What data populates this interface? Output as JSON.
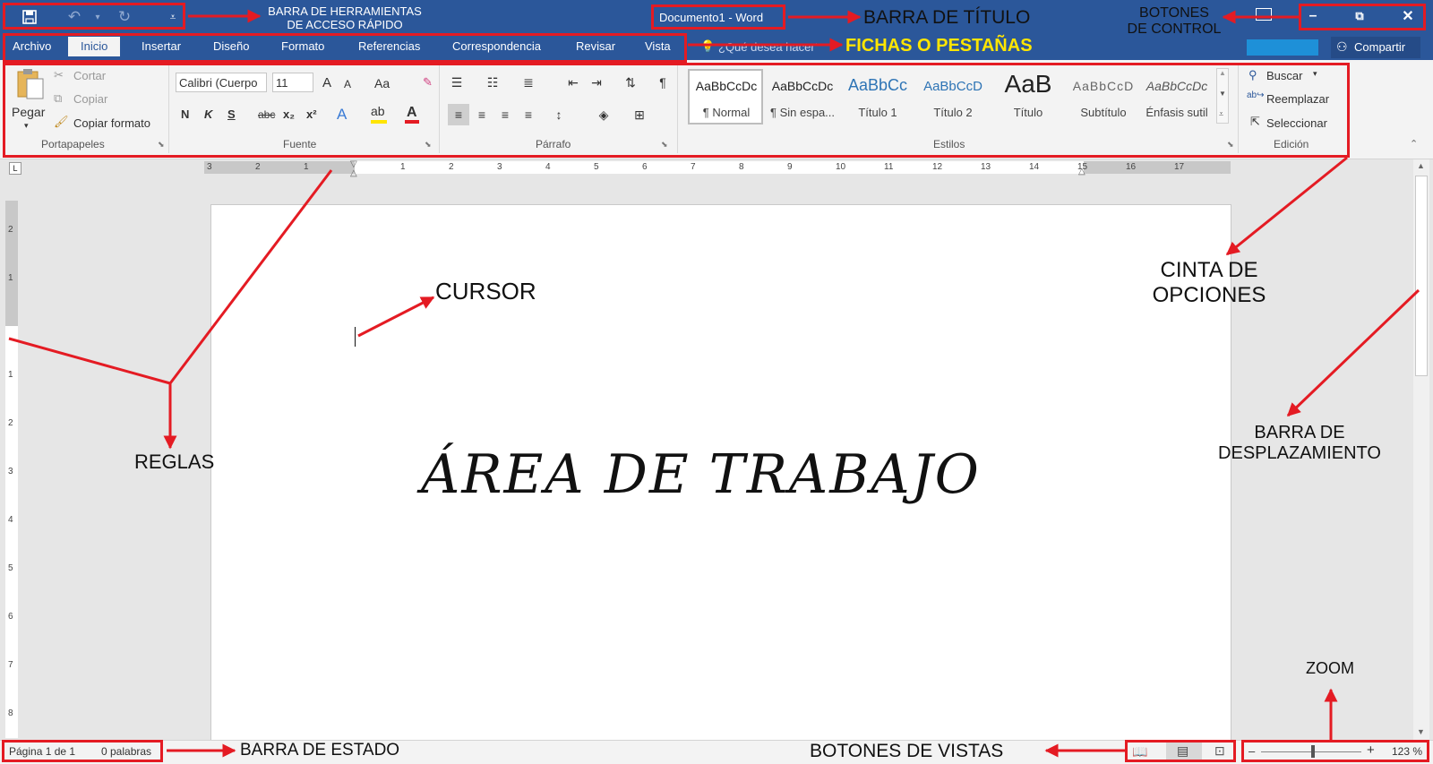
{
  "window": {
    "title": "Documento1 - Word",
    "controls": [
      "minimize-icon",
      "restore-icon",
      "close-icon"
    ]
  },
  "tabs": [
    {
      "label": "Archivo"
    },
    {
      "label": "Inicio",
      "active": true
    },
    {
      "label": "Insertar"
    },
    {
      "label": "Diseño"
    },
    {
      "label": "Formato"
    },
    {
      "label": "Referencias"
    },
    {
      "label": "Correspondencia"
    },
    {
      "label": "Revisar"
    },
    {
      "label": "Vista"
    }
  ],
  "tell_me": {
    "placeholder": "¿Qué desea hacer?"
  },
  "share": {
    "label": "Compartir"
  },
  "ribbon": {
    "clipboard": {
      "paste": "Pegar",
      "cut": "Cortar",
      "copy": "Copiar",
      "format_painter": "Copiar formato",
      "label": "Portapapeles"
    },
    "font": {
      "family": "Calibri (Cuerpo",
      "size": "11",
      "case": "Aa",
      "bold": "N",
      "italic": "K",
      "underline": "S",
      "strike": "abc",
      "sub": "x₂",
      "sup": "x²",
      "grow": "A",
      "shrink": "A",
      "label": "Fuente"
    },
    "paragraph": {
      "label": "Párrafo"
    },
    "styles": {
      "items": [
        {
          "sample": "AaBbCcDc",
          "name": "¶ Normal"
        },
        {
          "sample": "AaBbCcDc",
          "name": "¶ Sin espa..."
        },
        {
          "sample": "AaBbCc",
          "name": "Título 1"
        },
        {
          "sample": "AaBbCcD",
          "name": "Título 2"
        },
        {
          "sample": "AaB",
          "name": "Título"
        },
        {
          "sample": "AaBbCcD",
          "name": "Subtítulo"
        },
        {
          "sample": "AaBbCcDc",
          "name": "Énfasis sutil"
        }
      ],
      "label": "Estilos"
    },
    "editing": {
      "find": "Buscar",
      "replace": "Reemplazar",
      "select": "Seleccionar",
      "label": "Edición"
    }
  },
  "ruler": {
    "h_numbers": [
      "3",
      "2",
      "1",
      "1",
      "2",
      "3",
      "4",
      "5",
      "6",
      "7",
      "8",
      "9",
      "10",
      "11",
      "12",
      "13",
      "14",
      "15",
      "16",
      "17"
    ],
    "v_numbers": [
      "2",
      "1",
      "1",
      "2",
      "3",
      "4",
      "5",
      "6",
      "7",
      "8"
    ]
  },
  "document": {
    "text": "ÁREA DE TRABAJO"
  },
  "status": {
    "page": "Página 1 de 1",
    "words": "0 palabras",
    "zoom": "123 %"
  },
  "annotations": {
    "qat": "BARRA DE HERRAMIENTAS\nDE ACCESO RÁPIDO",
    "title": "BARRA DE TÍTULO",
    "controls": "BOTONES\nDE CONTROL",
    "tabs": "FICHAS O PESTAÑAS",
    "cursor": "CURSOR",
    "ribbon": "CINTA DE\nOPCIONES",
    "rulers": "REGLAS",
    "scroll": "BARRA DE\nDESPLAZAMIENTO",
    "zoom": "ZOOM",
    "status": "BARRA DE ESTADO",
    "views": "BOTONES DE VISTAS"
  },
  "colors": {
    "brand": "#2b579a",
    "annotation": "#e41b23",
    "tabs_label": "#ffe500"
  }
}
